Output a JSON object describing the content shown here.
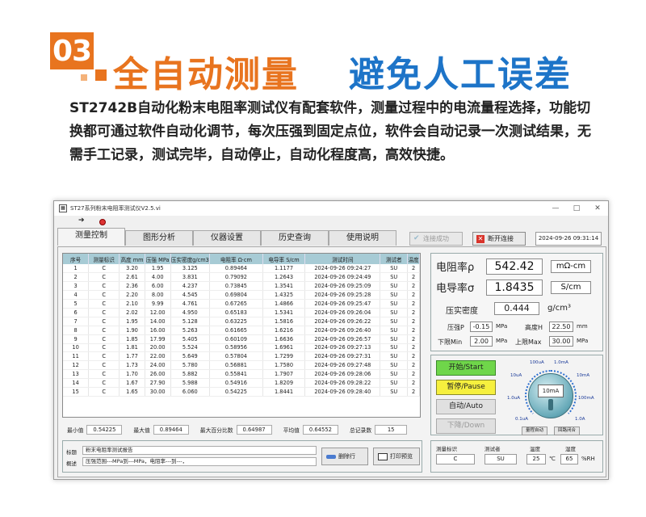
{
  "hero": {
    "badge": "03",
    "title_left": "全自动测量",
    "title_right": "避免人工误差",
    "description": "ST2742B自动化粉末电阻率测试仪有配套软件，测量过程中的电流量程选择，功能切换都可通过软件自动化调节，每次压强到固定点位，软件会自动记录一次测试结果，无需手工记录，测试完毕，自动停止，自动化程度高，高效快捷。"
  },
  "window": {
    "title": "ST27系列粉末电阻率测试仪V2.5.vi",
    "controls": [
      "—",
      "□",
      "✕"
    ],
    "tabs": [
      "测量控制",
      "图形分析",
      "仪器设置",
      "历史查询",
      "使用说明"
    ],
    "connect_ok": "连接成功",
    "disconnect": "断开连接",
    "datetime": "2024-09-26 09:31:14"
  },
  "table": {
    "headers": [
      "序号",
      "测量标识",
      "高度 mm",
      "压强 MPa",
      "压实密度g/cm3",
      "电阻率 Ω·cm",
      "电导率 S/cm",
      "测试时间",
      "测试者",
      "温度"
    ],
    "rows": [
      [
        "1",
        "C",
        "3.20",
        "1.95",
        "3.125",
        "0.89464",
        "1.1177",
        "2024-09-26 09:24:27",
        "SU",
        "2"
      ],
      [
        "2",
        "C",
        "2.61",
        "4.00",
        "3.831",
        "0.79092",
        "1.2643",
        "2024-09-26 09:24:49",
        "SU",
        "2"
      ],
      [
        "3",
        "C",
        "2.36",
        "6.00",
        "4.237",
        "0.73845",
        "1.3541",
        "2024-09-26 09:25:09",
        "SU",
        "2"
      ],
      [
        "4",
        "C",
        "2.20",
        "8.00",
        "4.545",
        "0.69804",
        "1.4325",
        "2024-09-26 09:25:28",
        "SU",
        "2"
      ],
      [
        "5",
        "C",
        "2.10",
        "9.99",
        "4.761",
        "0.67265",
        "1.4866",
        "2024-09-26 09:25:47",
        "SU",
        "2"
      ],
      [
        "6",
        "C",
        "2.02",
        "12.00",
        "4.950",
        "0.65183",
        "1.5341",
        "2024-09-26 09:26:04",
        "SU",
        "2"
      ],
      [
        "7",
        "C",
        "1.95",
        "14.00",
        "5.128",
        "0.63225",
        "1.5816",
        "2024-09-26 09:26:22",
        "SU",
        "2"
      ],
      [
        "8",
        "C",
        "1.90",
        "16.00",
        "5.263",
        "0.61665",
        "1.6216",
        "2024-09-26 09:26:40",
        "SU",
        "2"
      ],
      [
        "9",
        "C",
        "1.85",
        "17.99",
        "5.405",
        "0.60109",
        "1.6636",
        "2024-09-26 09:26:57",
        "SU",
        "2"
      ],
      [
        "10",
        "C",
        "1.81",
        "20.00",
        "5.524",
        "0.58956",
        "1.6961",
        "2024-09-26 09:27:13",
        "SU",
        "2"
      ],
      [
        "11",
        "C",
        "1.77",
        "22.00",
        "5.649",
        "0.57804",
        "1.7299",
        "2024-09-26 09:27:31",
        "SU",
        "2"
      ],
      [
        "12",
        "C",
        "1.73",
        "24.00",
        "5.780",
        "0.56881",
        "1.7580",
        "2024-09-26 09:27:48",
        "SU",
        "2"
      ],
      [
        "13",
        "C",
        "1.70",
        "26.00",
        "5.882",
        "0.55841",
        "1.7907",
        "2024-09-26 09:28:06",
        "SU",
        "2"
      ],
      [
        "14",
        "C",
        "1.67",
        "27.90",
        "5.988",
        "0.54916",
        "1.8209",
        "2024-09-26 09:28:22",
        "SU",
        "2"
      ],
      [
        "15",
        "C",
        "1.65",
        "30.00",
        "6.060",
        "0.54225",
        "1.8441",
        "2024-09-26 09:28:40",
        "SU",
        "2"
      ]
    ]
  },
  "stats": {
    "min_label": "最小值",
    "min": "0.54225",
    "max_label": "最大值",
    "max": "0.89464",
    "maxpct_label": "最大百分比数",
    "maxpct": "0.64987",
    "avg_label": "平均值",
    "avg": "0.64552",
    "total_label": "总记录数",
    "total": "15"
  },
  "readout": {
    "resistivity_label": "电阻率ρ",
    "resistivity": "542.42",
    "resistivity_unit": "mΩ-cm",
    "conductivity_label": "电导率σ",
    "conductivity": "1.8435",
    "conductivity_unit": "S/cm",
    "density_label": "压实密度",
    "density": "0.444",
    "density_unit": "g/cm³",
    "pressure_label": "压强P",
    "pressure": "-0.15",
    "pressure_unit": "MPa",
    "height_label": "高度H",
    "height": "22.50",
    "height_unit": "mm",
    "lower_label": "下限Min",
    "lower": "2.00",
    "lower_unit": "MPa",
    "upper_label": "上限Max",
    "upper": "30.00",
    "upper_unit": "MPa"
  },
  "control": {
    "start": "开始/Start",
    "pause": "暂停/Pause",
    "auto": "自动/Auto",
    "down": "下降/Down",
    "dial_value": "10mA",
    "dial_labels": [
      "100uA",
      "1.0mA",
      "10uA",
      "10mA",
      "1.0uA",
      "100mA",
      "0.1uA",
      "1.0A"
    ],
    "range_auto": "量程自动",
    "loop_close": "回路闭合"
  },
  "bottom": {
    "title_label": "标题",
    "title_value": "粉末电阻率测试报告",
    "desc_label": "概述",
    "desc_value": "压强范围---MPa到---MPa，电阻率---到---，",
    "delete_row": "删除行",
    "print_preview": "打印预览"
  },
  "info": {
    "id_label": "测量标识",
    "id_value": "C",
    "tester_label": "测试者",
    "tester_value": "SU",
    "temp_label": "温度",
    "temp_value": "25",
    "temp_unit": "℃",
    "humidity_label": "湿度",
    "humidity_value": "65",
    "humidity_unit": "%RH"
  }
}
